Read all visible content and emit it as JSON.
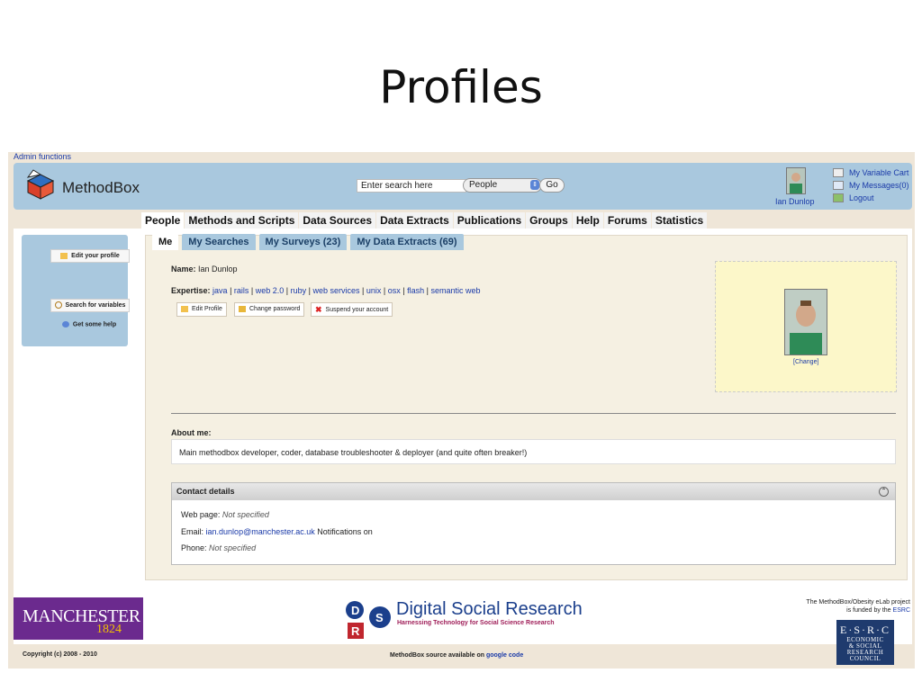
{
  "slide": {
    "title": "Profiles"
  },
  "admin": {
    "link": "Admin functions"
  },
  "header": {
    "app_name": "MethodBox",
    "search_placeholder": "Enter search here",
    "search_scope": "People",
    "go_label": "Go",
    "user_name": "Ian Dunlop",
    "links": [
      "My Variable Cart",
      "My Messages(0)",
      "Logout"
    ]
  },
  "nav": {
    "tabs": [
      "People",
      "Methods and Scripts",
      "Data Sources",
      "Data Extracts",
      "Publications",
      "Groups",
      "Help",
      "Forums",
      "Statistics"
    ]
  },
  "sidebar": {
    "edit_profile": "Edit your profile",
    "search_variables": "Search for variables",
    "get_help": "Get some help"
  },
  "subtabs": [
    "Me",
    "My Searches",
    "My Surveys (23)",
    "My Data Extracts (69)"
  ],
  "profile": {
    "name_label": "Name:",
    "name": "Ian Dunlop",
    "expertise_label": "Expertise:",
    "expertise": [
      "java",
      "rails",
      "web 2.0",
      "ruby",
      "web services",
      "unix",
      "osx",
      "flash",
      "semantic web"
    ],
    "buttons": [
      "Edit Profile",
      "Change password",
      "Suspend your account"
    ],
    "change_photo": "[Change]",
    "about_label": "About me:",
    "about": "Main methodbox developer, coder, database troubleshooter & deployer (and quite often breaker!)"
  },
  "contact": {
    "title": "Contact details",
    "web_label": "Web page:",
    "web_value": "Not specified",
    "email_label": "Email:",
    "email": "ian.dunlop@manchester.ac.uk",
    "notifications": "Notifications on",
    "phone_label": "Phone:",
    "phone_value": "Not specified"
  },
  "footer": {
    "manchester_text": "MANCHESTER",
    "manchester_year": "1824",
    "copyright": "Copyright (c) 2008 - 2010",
    "dsr_title": "Digital Social Research",
    "dsr_subtitle": "Harnessing Technology for Social Science Research",
    "source_text": "MethodBox source available on",
    "source_link": "google code",
    "funded_text": "The MethodBox/Obesity eLab project is funded by the",
    "funded_link": "ESRC",
    "esrc_top": "E·S·R·C",
    "esrc_lines": [
      "ECONOMIC",
      "& SOCIAL",
      "RESEARCH",
      "COUNCIL"
    ]
  },
  "colors": {
    "header_blue": "#a9c8de",
    "link_blue": "#1a3aa8",
    "panel_beige": "#f5f0e2",
    "manchester_purple": "#6b2a8e"
  }
}
